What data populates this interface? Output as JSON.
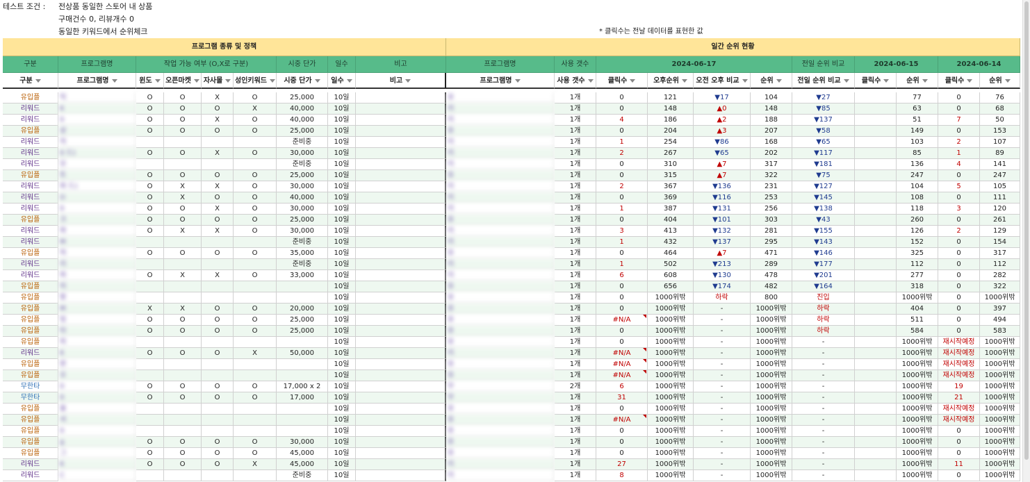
{
  "conditions": {
    "label": "테스트 조건 :",
    "line1": "전상품 동일한 스토어 내 상품",
    "line2": "구매건수 0, 리뷰개수 0",
    "line3": "동일한 키워드에서 순위체크",
    "note": "* 클릭수는 전날 데이터를 표현한 값"
  },
  "sections": {
    "left": "프로그램 종류 및 정책",
    "right": "일간 순위 현황"
  },
  "group_headers": {
    "gubun": "구분",
    "program": "프로그램명",
    "work": "작업 가능 여부 (O,X로 구분)",
    "price": "시중 단가",
    "days": "일수",
    "note": "비고",
    "program2": "프로그램명",
    "count": "사용 갯수",
    "date1": "2024-06-17",
    "prev_compare": "전일 순위 비교",
    "date2": "2024-06-15",
    "date3": "2024-06-14"
  },
  "columns": [
    "구분",
    "프로그램명",
    "윈도",
    "오픈마켓",
    "자사몰",
    "성인키워드",
    "시중 단가",
    "일수",
    "비고",
    "프로그램명",
    "사용 갯수",
    "클릭수",
    "오후순위",
    "오전 오후 비교",
    "순위",
    "전일 순위 비교",
    "클릭수",
    "순위",
    "클릭수",
    "순위"
  ],
  "colors": {
    "yellow": "#ffe599",
    "green": "#57bb8a",
    "odd_row": "#eef8f0",
    "up": "#c00000",
    "down": "#1f3b8f"
  },
  "rows": [
    [
      "유입플",
      "익",
      "O",
      "O",
      "X",
      "O",
      "25,000",
      "10일",
      "",
      "유",
      "1개",
      "0",
      "121",
      "▼17",
      "104",
      "▼27",
      "",
      "77",
      "0",
      "76"
    ],
    [
      "리워드",
      "K",
      "O",
      "O",
      "O",
      "X",
      "40,000",
      "10일",
      "",
      "리",
      "1개",
      "0",
      "148",
      "▲0",
      "148",
      "▼85",
      "",
      "63",
      "0",
      "68"
    ],
    [
      "리워드",
      "0",
      "O",
      "O",
      "X",
      "O",
      "40,000",
      "10일",
      "",
      "리",
      "1개",
      "4",
      "186",
      "▲2",
      "188",
      "▼137",
      "",
      "51",
      "7",
      "50"
    ],
    [
      "유입플",
      "상",
      "O",
      "O",
      "O",
      "O",
      "25,000",
      "10일",
      "",
      "유",
      "1개",
      "0",
      "204",
      "▲3",
      "207",
      "▼58",
      "",
      "149",
      "0",
      "153"
    ],
    [
      "리워드",
      "히",
      "",
      "",
      "",
      "",
      "준비중",
      "10일",
      "",
      "리",
      "1개",
      "1",
      "254",
      "▼86",
      "168",
      "▼65",
      "",
      "103",
      "2",
      "107"
    ],
    [
      "리워드",
      "0 드)",
      "O",
      "O",
      "X",
      "O",
      "30,000",
      "10일",
      "",
      "리",
      "1개",
      "2",
      "267",
      "▼65",
      "202",
      "▼117",
      "",
      "85",
      "1",
      "89"
    ],
    [
      "리워드",
      "모",
      "",
      "",
      "",
      "",
      "준비중",
      "10일",
      "",
      "리",
      "1개",
      "0",
      "310",
      "▲7",
      "317",
      "▼181",
      "",
      "136",
      "4",
      "141"
    ],
    [
      "유입플",
      "트",
      "O",
      "O",
      "O",
      "O",
      "25,000",
      "10일",
      "",
      "유",
      "1개",
      "0",
      "315",
      "▲7",
      "322",
      "▼75",
      "",
      "247",
      "0",
      "247"
    ],
    [
      "리워드",
      "파 드)",
      "O",
      "X",
      "X",
      "O",
      "30,000",
      "10일",
      "",
      "리",
      "1개",
      "2",
      "367",
      "▼136",
      "231",
      "▼127",
      "",
      "104",
      "5",
      "105"
    ],
    [
      "리워드",
      "O",
      "O",
      "X",
      "O",
      "O",
      "40,000",
      "10일",
      "",
      "리",
      "1개",
      "0",
      "369",
      "▼116",
      "253",
      "▼145",
      "",
      "108",
      "0",
      "111"
    ],
    [
      "리워드",
      "0",
      "O",
      "O",
      "X",
      "O",
      "30,000",
      "10일",
      "",
      "리",
      "1개",
      "1",
      "387",
      "▼131",
      "256",
      "▼138",
      "",
      "118",
      "3",
      "120"
    ],
    [
      "유입플",
      "크",
      "O",
      "O",
      "O",
      "O",
      "25,000",
      "10일",
      "",
      "유",
      "1개",
      "0",
      "404",
      "▼101",
      "303",
      "▼43",
      "",
      "260",
      "0",
      "261"
    ],
    [
      "리워드",
      "파",
      "O",
      "X",
      "X",
      "O",
      "30,000",
      "10일",
      "",
      "리",
      "1개",
      "3",
      "413",
      "▼132",
      "281",
      "▼155",
      "",
      "126",
      "2",
      "129"
    ],
    [
      "리워드",
      "M",
      "",
      "",
      "",
      "",
      "준비중",
      "10일",
      "",
      "리",
      "1개",
      "1",
      "432",
      "▼137",
      "295",
      "▼143",
      "",
      "152",
      "0",
      "154"
    ],
    [
      "유입플",
      "허",
      "O",
      "O",
      "O",
      "O",
      "35,000",
      "10일",
      "",
      "유",
      "1개",
      "0",
      "464",
      "▲7",
      "471",
      "▼146",
      "",
      "325",
      "0",
      "317"
    ],
    [
      "리워드",
      "리",
      "",
      "",
      "",
      "",
      "준비중",
      "10일",
      "",
      "리",
      "1개",
      "1",
      "502",
      "▼213",
      "289",
      "▼177",
      "",
      "112",
      "0",
      "112"
    ],
    [
      "리워드",
      "퍼",
      "O",
      "X",
      "X",
      "O",
      "33,000",
      "10일",
      "",
      "리",
      "1개",
      "6",
      "608",
      "▼130",
      "478",
      "▼201",
      "",
      "277",
      "0",
      "282"
    ],
    [
      "유입플",
      "미",
      "",
      "",
      "",
      "",
      "",
      "10일",
      "",
      "유",
      "1개",
      "0",
      "656",
      "▼174",
      "482",
      "▼164",
      "",
      "318",
      "0",
      "322"
    ],
    [
      "유입플",
      "팡",
      "",
      "",
      "",
      "",
      "",
      "10일",
      "",
      "유",
      "1개",
      "0",
      "1000위밖",
      "하락",
      "800",
      "진입",
      "",
      "1000위밖",
      "0",
      "1000위밖"
    ],
    [
      "유입플",
      "M",
      "X",
      "X",
      "O",
      "O",
      "20,000",
      "10일",
      "",
      "유",
      "1개",
      "0",
      "1000위밖",
      "-",
      "1000위밖",
      "하락",
      "",
      "404",
      "0",
      "397"
    ],
    [
      "유입플",
      "빙",
      "O",
      "O",
      "O",
      "O",
      "25,000",
      "10일",
      "",
      "유",
      "1개",
      "#N/A",
      "1000위밖",
      "-",
      "1000위밖",
      "하락",
      "",
      "511",
      "0",
      "494"
    ],
    [
      "유입플",
      "타",
      "O",
      "O",
      "O",
      "O",
      "25,000",
      "10일",
      "",
      "유",
      "1개",
      "0",
      "1000위밖",
      "-",
      "1000위밖",
      "하락",
      "",
      "584",
      "0",
      "583"
    ],
    [
      "유입플",
      "피",
      "",
      "",
      "",
      "",
      "",
      "10일",
      "",
      "유",
      "1개",
      "0",
      "1000위밖",
      "-",
      "1000위밖",
      "-",
      "",
      "1000위밖",
      "재시작예정",
      "1000위밖"
    ],
    [
      "리워드",
      "K",
      "O",
      "O",
      "O",
      "X",
      "50,000",
      "10일",
      "",
      "리",
      "1개",
      "#N/A",
      "1000위밖",
      "-",
      "1000위밖",
      "-",
      "",
      "1000위밖",
      "재시작예정",
      "1000위밖"
    ],
    [
      "유입플",
      "판",
      "",
      "",
      "",
      "",
      "",
      "10일",
      "",
      "유",
      "1개",
      "#N/A",
      "1000위밖",
      "-",
      "1000위밖",
      "-",
      "",
      "1000위밖",
      "재시작예정",
      "1000위밖"
    ],
    [
      "유입플",
      "오",
      "",
      "",
      "",
      "",
      "",
      "10일",
      "",
      "유",
      "1개",
      "#N/A",
      "1000위밖",
      "-",
      "1000위밖",
      "-",
      "",
      "1000위밖",
      "재시작예정",
      "1000위밖"
    ],
    [
      "무한타",
      "0",
      "O",
      "O",
      "O",
      "O",
      "17,000 x 2",
      "10일",
      "",
      "무",
      "2개",
      "6",
      "1000위밖",
      "-",
      "1000위밖",
      "-",
      "",
      "1000위밖",
      "19",
      "1000위밖"
    ],
    [
      "무한타",
      "0",
      "O",
      "O",
      "O",
      "O",
      "17,000",
      "10일",
      "",
      "무",
      "1개",
      "31",
      "1000위밖",
      "-",
      "1000위밖",
      "-",
      "",
      "1000위밖",
      "21",
      "1000위밖"
    ],
    [
      "유입플",
      "쏠",
      "",
      "",
      "",
      "",
      "",
      "10일",
      "",
      "유",
      "1개",
      "0",
      "1000위밖",
      "-",
      "1000위밖",
      "-",
      "",
      "1000위밖",
      "재시작예정",
      "1000위밖"
    ],
    [
      "유입플",
      "서",
      "",
      "",
      "",
      "",
      "",
      "10일",
      "",
      "유",
      "1개",
      "#N/A",
      "1000위밖",
      "-",
      "1000위밖",
      "-",
      "",
      "1000위밖",
      "재시작예정",
      "1000위밖"
    ],
    [
      "유입플",
      "0",
      "",
      "",
      "",
      "",
      "",
      "10일",
      "",
      "유",
      "1개",
      "0",
      "1000위밖",
      "-",
      "1000위밖",
      "-",
      "",
      "1000위밖",
      "0",
      "1000위밖"
    ],
    [
      "유입플",
      "g",
      "O",
      "O",
      "O",
      "O",
      "30,000",
      "10일",
      "",
      "유",
      "1개",
      "0",
      "1000위밖",
      "-",
      "1000위밖",
      "-",
      "",
      "1000위밖",
      "0",
      "1000위밖"
    ],
    [
      "유입플",
      "그",
      "O",
      "O",
      "O",
      "O",
      "45,000",
      "10일",
      "",
      "유",
      "1개",
      "0",
      "1000위밖",
      "-",
      "1000위밖",
      "-",
      "",
      "1000위밖",
      "0",
      "1000위밖"
    ],
    [
      "리워드",
      "K",
      "O",
      "O",
      "O",
      "X",
      "45,000",
      "10일",
      "",
      "리",
      "1개",
      "27",
      "1000위밖",
      "-",
      "1000위밖",
      "-",
      "",
      "1000위밖",
      "11",
      "1000위밖"
    ],
    [
      "리워드",
      "C",
      "",
      "",
      "",
      "",
      "준비중",
      "10일",
      "",
      "리",
      "1개",
      "8",
      "1000위밖",
      "-",
      "1000위밖",
      "-",
      "",
      "1000위밖",
      "0",
      "1000위밖"
    ]
  ]
}
